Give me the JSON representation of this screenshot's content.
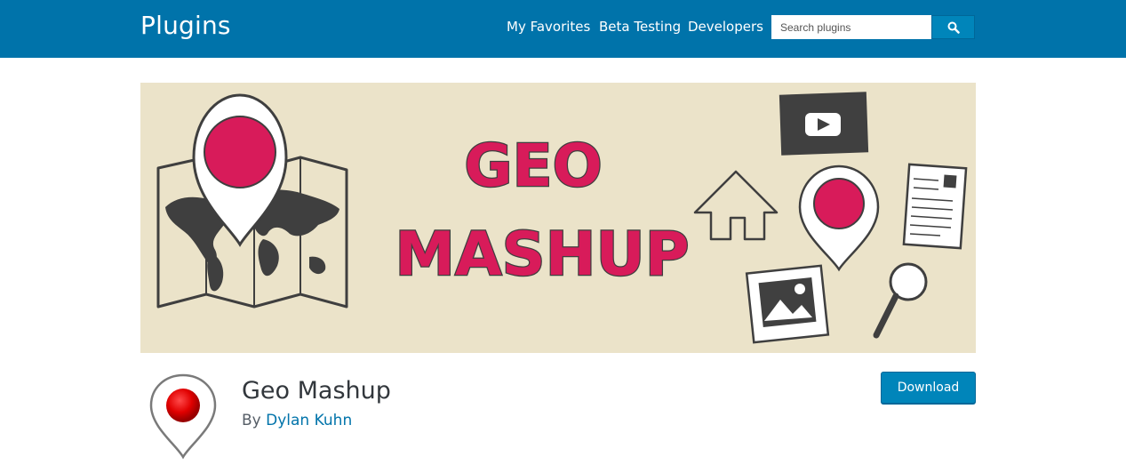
{
  "header": {
    "title": "Plugins",
    "nav": [
      "My Favorites",
      "Beta Testing",
      "Developers"
    ],
    "search_placeholder": "Search plugins",
    "search_icon": "search-icon"
  },
  "banner": {
    "line1": "GEO",
    "line2": "MASHUP"
  },
  "plugin": {
    "name": "Geo Mashup",
    "by_prefix": "By",
    "author": "Dylan Kuhn",
    "download_label": "Download"
  },
  "colors": {
    "header_bg": "#0073aa",
    "banner_bg": "#ebe3c9",
    "brand_pink": "#d81b5a",
    "link": "#0073aa",
    "button": "#0085ba"
  }
}
